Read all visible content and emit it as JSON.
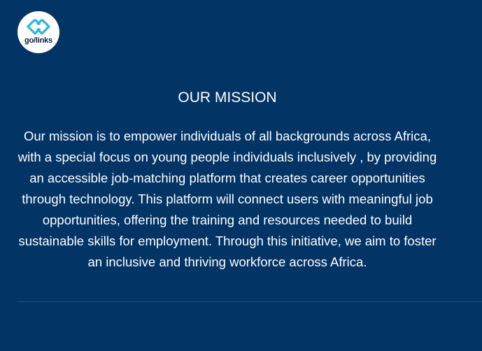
{
  "logo": {
    "text": "go/links",
    "icon": "golinks-logo-icon",
    "accent_color": "#2fb6d8"
  },
  "mission": {
    "title": "OUR MISSION",
    "body": "Our mission is to empower individuals of all backgrounds across Africa, with a special focus on young people individuals inclusively , by providing an accessible job-matching platform that creates career opportunities through technology. This platform will connect users with meaningful job opportunities, offering the training and resources needed to build sustainable skills for employment. Through this initiative, we aim to foster an inclusive and thriving workforce across Africa."
  },
  "colors": {
    "background": "#023466",
    "text": "#ffffff"
  }
}
